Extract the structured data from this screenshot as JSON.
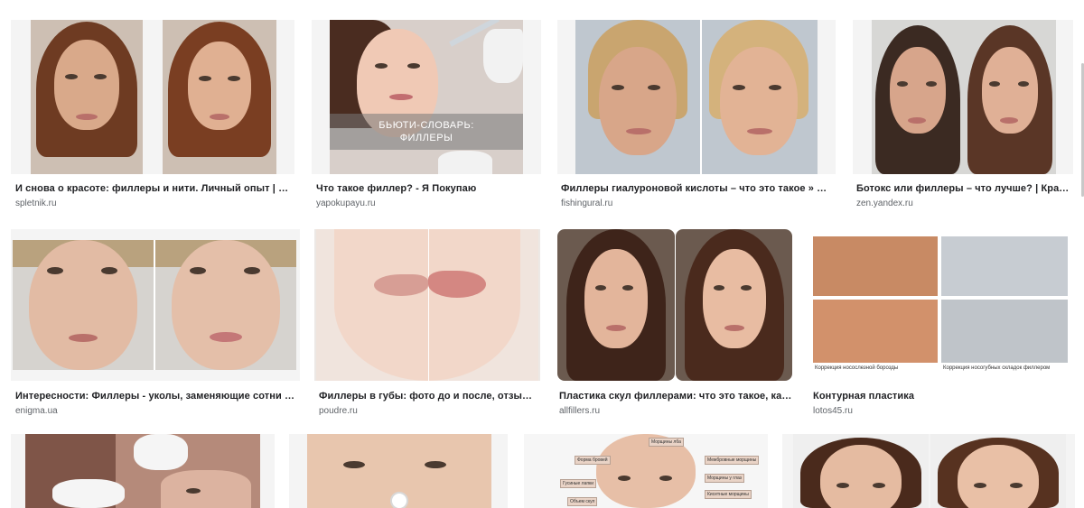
{
  "top_text": "",
  "results": [
    {
      "title": "И снова о красоте: филлеры и нити. Личный опыт | Б…",
      "source": "spletnik.ru"
    },
    {
      "title": "Что такое филлер? - Я Покупаю",
      "source": "yapokupayu.ru",
      "overlay": "БЬЮТИ-СЛОВАРЬ:\nФИЛЛЕРЫ"
    },
    {
      "title": "Филлеры гиалуроновой кислоты – что это такое » Р…",
      "source": "fishingural.ru"
    },
    {
      "title": "Ботокс или филлеры – что лучше? | Крас…",
      "source": "zen.yandex.ru"
    },
    {
      "title": "Интересности: Филлеры - уколы, заменяющие сотни …",
      "source": "enigma.ua"
    },
    {
      "title": "Филлеры в губы: фото до и после, отзыв…",
      "source": "poudre.ru"
    },
    {
      "title": "Пластика скул филлерами: что это такое, ка…",
      "source": "allfillers.ru"
    },
    {
      "title": "Контурная пластика",
      "source": "lotos45.ru",
      "sub_captions": [
        "Коррекция носослезной борозды",
        "Коррекция носогубных складок филлером"
      ]
    },
    {
      "title": "",
      "source": ""
    },
    {
      "title": "",
      "source": ""
    },
    {
      "title": "",
      "source": "",
      "tags": [
        "Морщины лба",
        "Межбровные морщины",
        "Форма бровей",
        "Гусиные лапки",
        "Морщины у глаз",
        "Кисетные морщины",
        "Объем скул"
      ]
    },
    {
      "title": "",
      "source": ""
    }
  ],
  "colors": {
    "title": "#202124",
    "source": "#5f6368",
    "thumb_bg": "#f1f3f4"
  }
}
